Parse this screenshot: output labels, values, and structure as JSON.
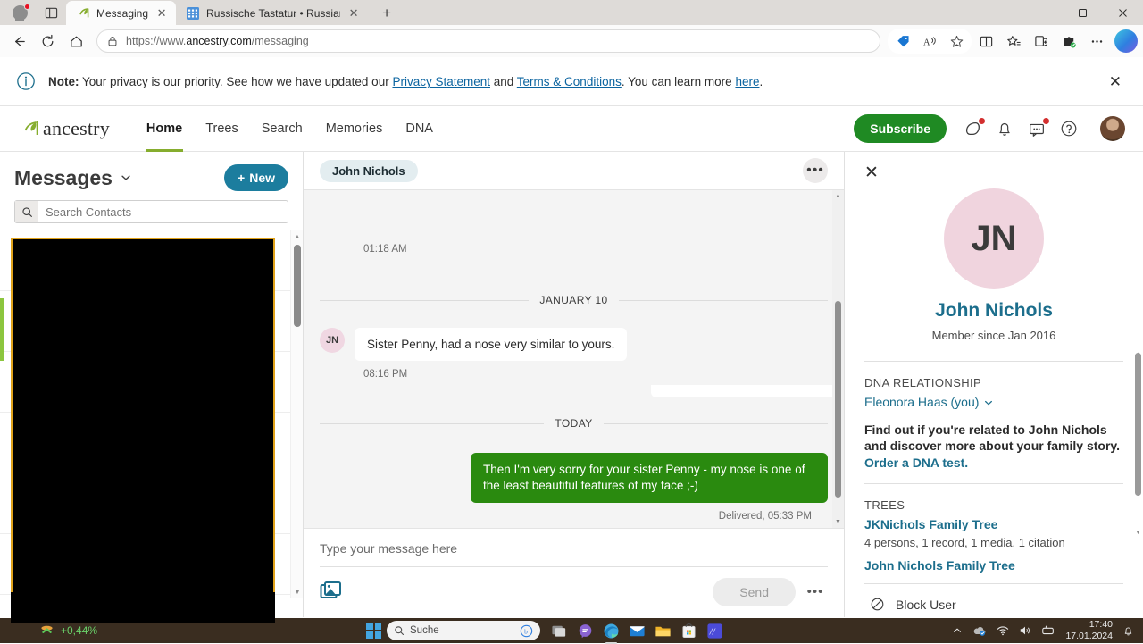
{
  "browser": {
    "tabs": [
      {
        "title": "Messaging",
        "favicon": "ancestry-leaf-icon",
        "active": true
      },
      {
        "title": "Russische Tastatur • Russian Keyb",
        "favicon": "keyboard-icon",
        "active": false
      }
    ],
    "newtab_label": "+",
    "url_scheme": "https://www.",
    "url_host": "ancestry.com",
    "url_path": "/messaging",
    "window_controls": {
      "minimize": "–",
      "maximize": "▢",
      "close": "✕"
    }
  },
  "notice": {
    "label": "Note:",
    "text_1": " Your privacy is our priority. See how we have updated our ",
    "link_privacy": "Privacy Statement",
    "text_2": " and ",
    "link_terms": "Terms & Conditions",
    "text_3": ". You can learn more ",
    "link_here": "here",
    "text_4": ".",
    "close": "✕"
  },
  "header": {
    "brand": "ancestry",
    "nav": [
      {
        "label": "Home",
        "active": true
      },
      {
        "label": "Trees",
        "active": false
      },
      {
        "label": "Search",
        "active": false
      },
      {
        "label": "Memories",
        "active": false
      },
      {
        "label": "DNA",
        "active": false
      }
    ],
    "subscribe_label": "Subscribe",
    "icons": [
      "leaf-hint-icon",
      "bell-icon",
      "messages-icon",
      "help-icon"
    ],
    "avatar": "user-avatar"
  },
  "sidebar": {
    "title": "Messages",
    "chevron": "chevron-down-icon",
    "new_button": "New",
    "new_plus": "+",
    "search_placeholder": "Search Contacts",
    "search_value": ""
  },
  "conversation": {
    "contact_chip": "John Nichols",
    "more": "•••",
    "top_stamp": "01:18 AM",
    "dividers": {
      "january": "JANUARY 10",
      "today": "TODAY"
    },
    "messages": [
      {
        "direction": "in",
        "initials": "JN",
        "text": "Sister Penny, had a nose very similar to yours.",
        "stamp": "08:16 PM"
      },
      {
        "direction": "out",
        "text": "Then I'm very sorry for your sister Penny - my nose is one of the least beautiful features of my face ;-)",
        "stamp": "Delivered, 05:33 PM"
      }
    ]
  },
  "composer": {
    "placeholder": "Type your message here",
    "value": "",
    "attach_icon": "image-attach-icon",
    "send_label": "Send",
    "more": "•••"
  },
  "profile": {
    "close": "✕",
    "initials": "JN",
    "name": "John Nichols",
    "member_since": "Member since Jan 2016",
    "dna_section_title": "DNA RELATIONSHIP",
    "dna_person": "Eleonora Haas (you)",
    "dna_chevron": "chevron-down-icon",
    "dna_text_1": "Find out if you're related to John Nichols and discover more about your family story. ",
    "dna_link": "Order a DNA test.",
    "trees_section_title": "TREES",
    "trees": [
      {
        "name": "JKNichols Family Tree",
        "detail": "4 persons, 1 record, 1 media, 1 citation"
      },
      {
        "name": "John Nichols Family Tree",
        "detail": ""
      }
    ],
    "block_label": "Block User",
    "block_icon": "block-icon"
  },
  "taskbar": {
    "ticker": "+0,44%",
    "search_placeholder": "Suche",
    "apps": [
      "task-view-icon",
      "chat-icon",
      "edge-icon",
      "mail-icon",
      "file-explorer-icon",
      "store-icon",
      "app-icon"
    ],
    "time": "17:40",
    "date": "17.01.2024",
    "tray": [
      "chevron-up-icon",
      "onedrive-icon",
      "wifi-icon",
      "volume-icon",
      "battery-icon",
      "notification-icon"
    ]
  },
  "colors": {
    "accent_green": "#86ad2e",
    "subscribe_green": "#1f8a23",
    "bubble_green": "#2a8a0f",
    "teal": "#1c7d9e",
    "link_blue": "#0b64a0",
    "overlay_border": "#e0a21a"
  }
}
